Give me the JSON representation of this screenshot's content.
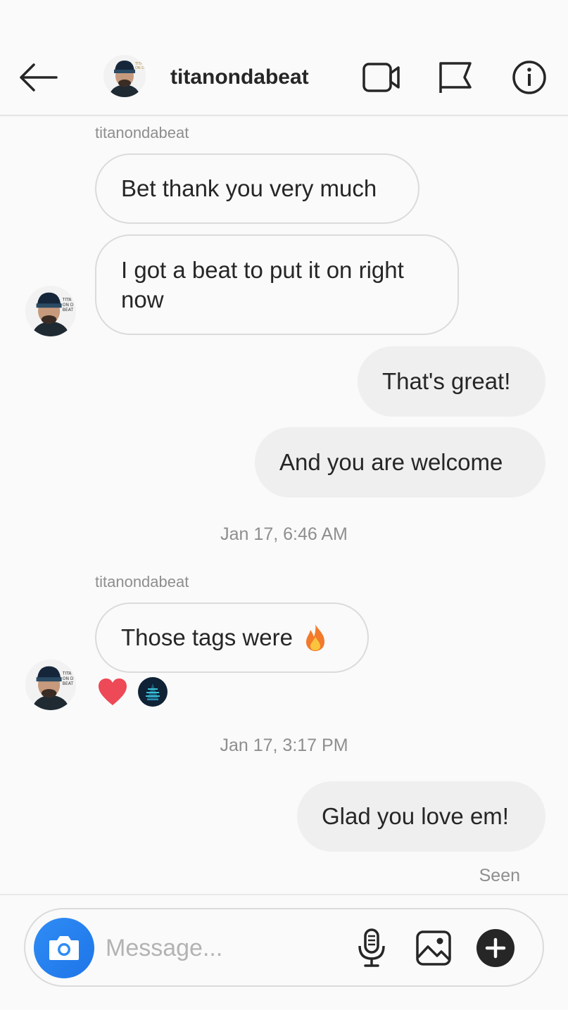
{
  "header": {
    "username": "titanondabeat"
  },
  "messages": {
    "group1_sender": "titanondabeat",
    "msg1": "Bet thank you very much",
    "msg2": "I got a beat to put it on right now",
    "msg3": "That's great!",
    "msg4": "And you are welcome",
    "timestamp1": "Jan 17, 6:46 AM",
    "group2_sender": "titanondabeat",
    "msg5": "Those tags were",
    "msg5_emoji": "fire-emoji",
    "timestamp2": "Jan 17, 3:17 PM",
    "msg6": "Glad you love em!",
    "seen": "Seen"
  },
  "reactions": [
    "heart",
    "user-avatar"
  ],
  "composer": {
    "placeholder": "Message..."
  },
  "colors": {
    "background": "#fafafa",
    "incoming_border": "#dbdbdb",
    "outgoing_bubble": "#efefef",
    "camera_button": "#2f8cf4",
    "heart": "#ed4956",
    "meta_text": "#8e8e8e"
  }
}
